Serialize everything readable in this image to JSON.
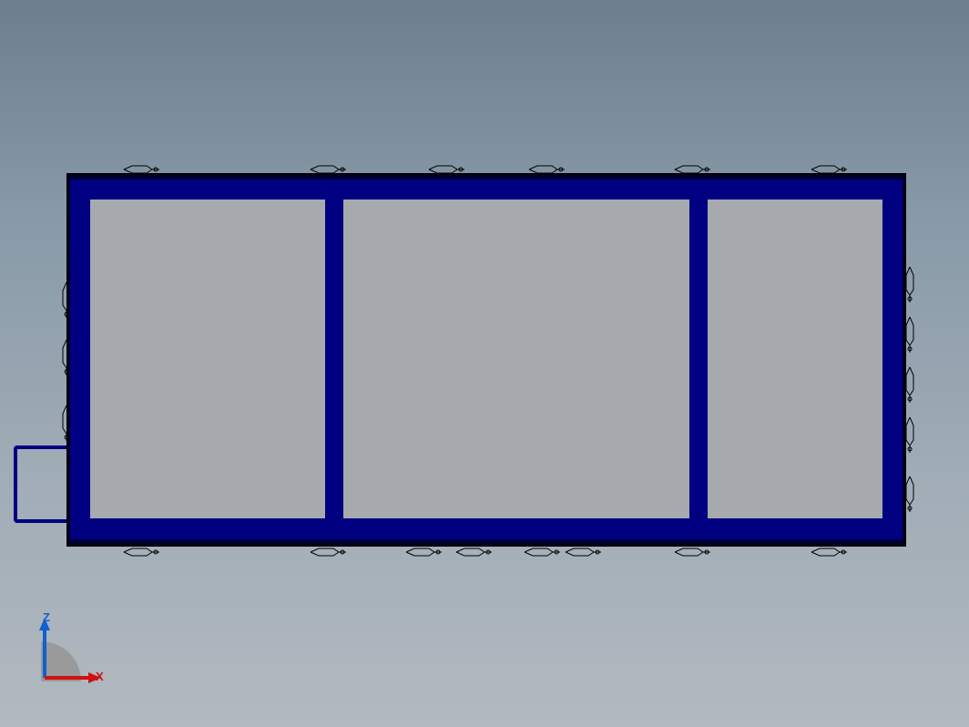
{
  "triad": {
    "x_label": "X",
    "z_label": "Z"
  },
  "model": {
    "frame_color": "#000080",
    "panel_color": "#a6a9ad",
    "panel_count": 3
  },
  "axis_colors": {
    "x": "#d01010",
    "z": "#1060d0"
  }
}
